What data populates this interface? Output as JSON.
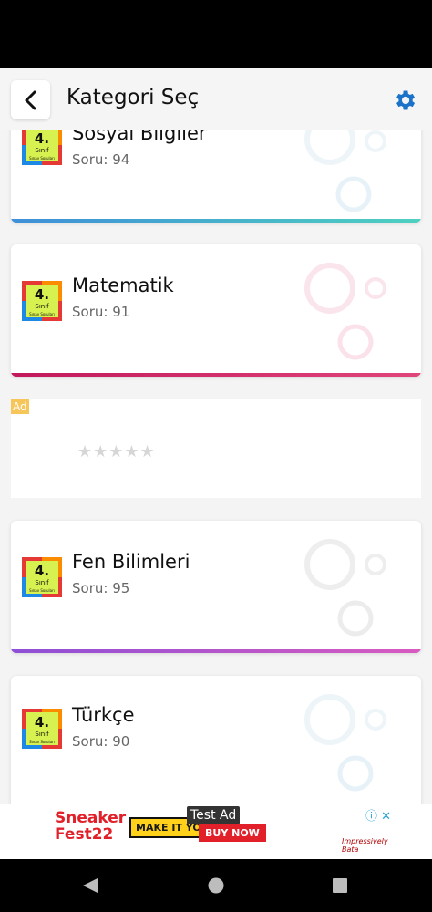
{
  "app": {
    "title": "Kategori Seç"
  },
  "categories": [
    {
      "name": "Sosyal Bilgiler",
      "sub": "Soru: 94",
      "badge": {
        "num": "4.",
        "line1": "Sınıf",
        "line2": "Sınav Soruları"
      }
    },
    {
      "name": "Matematik",
      "sub": "Soru: 91",
      "badge": {
        "num": "4.",
        "line1": "Sınıf",
        "line2": "Sınav Soruları"
      }
    },
    {
      "name": "Fen Bilimleri",
      "sub": "Soru: 95",
      "badge": {
        "num": "4.",
        "line1": "Sınıf",
        "line2": "Sınav Soruları"
      }
    },
    {
      "name": "Türkçe",
      "sub": "Soru: 90",
      "badge": {
        "num": "4.",
        "line1": "Sınıf",
        "line2": "Sınav Soruları"
      }
    }
  ],
  "ad": {
    "tag": "Ad",
    "stars": "★★★★★",
    "rating": 0
  },
  "bottom_ad": {
    "label": "Test Ad",
    "brand_line1": "Sneaker",
    "brand_line2": "Fest22",
    "promo": "MAKE IT YOURS",
    "cta": "BUY NOW",
    "tagline": "Impressively Bata"
  },
  "icons": {
    "back": "chevron-left-icon",
    "settings": "gear-icon",
    "adchoices": "adchoices-icon",
    "close": "close-icon"
  },
  "colors": {
    "accent": "#1a73c8",
    "cardBarBlue": "#3fb3d8",
    "cardBarPink": "#d81b78",
    "cardBarPurple": "#9c52d8"
  }
}
